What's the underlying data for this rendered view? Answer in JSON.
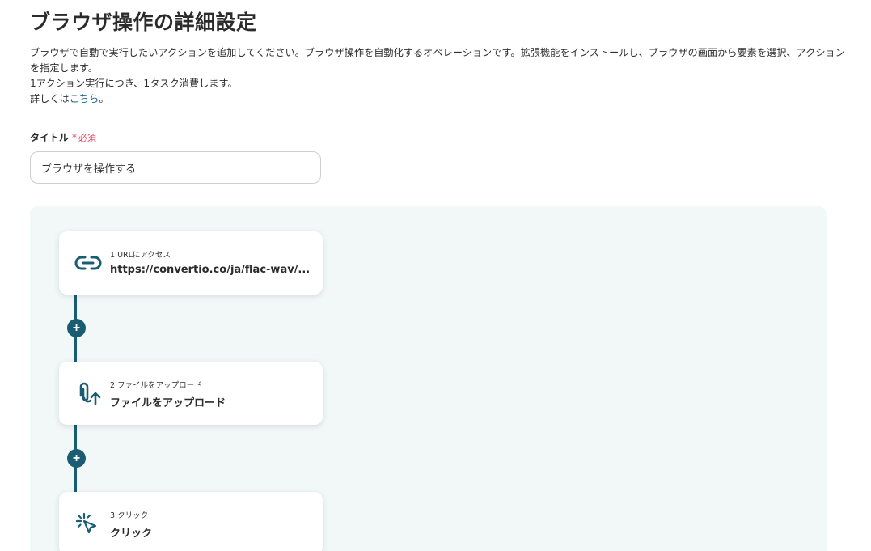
{
  "page": {
    "title": "ブラウザ操作の詳細設定",
    "description": [
      "ブラウザで自動で実行したいアクションを追加してください。ブラウザ操作を自動化するオペレーションです。拡張機能をインストールし、ブラウザの画面から要素を選択、アクション",
      "を指定します。",
      "1アクション実行につき、1タスク消費します。"
    ],
    "details_prefix": "詳しくは",
    "details_link": "こちら",
    "details_suffix": "。"
  },
  "title_field": {
    "label": "タイトル",
    "required_star": "*",
    "required_text": "必須",
    "value": "ブラウザを操作する"
  },
  "colors": {
    "accent": "#1a5d73",
    "required": "#e0435b",
    "canvas_bg": "#f2f8f8"
  },
  "steps": [
    {
      "icon": "link-icon",
      "subtitle": "1.URLにアクセス",
      "main": "https://convertio.co/ja/flac-wav/..."
    },
    {
      "icon": "paperclip-upload-icon",
      "subtitle": "2.ファイルをアップロード",
      "main": "ファイルをアップロード"
    },
    {
      "icon": "click-cursor-icon",
      "subtitle": "3.クリック",
      "main": "クリック"
    }
  ],
  "add_step": {
    "label": "+"
  }
}
